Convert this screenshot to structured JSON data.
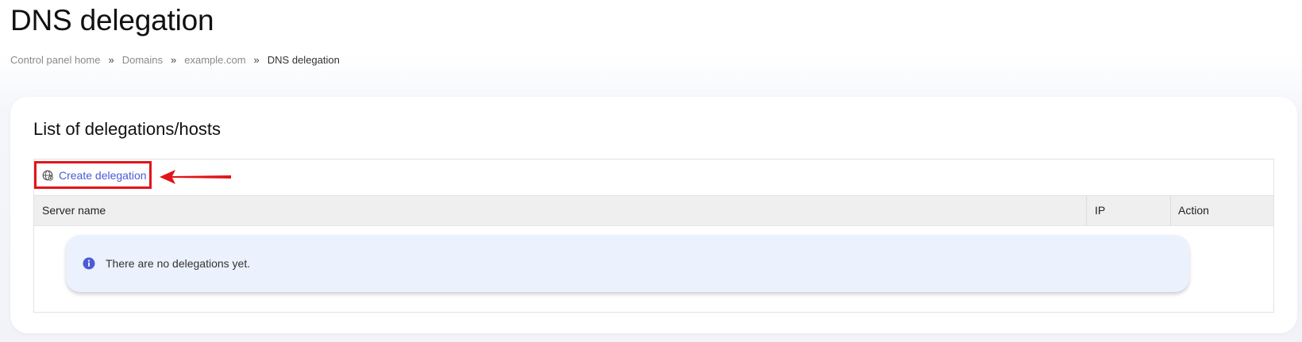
{
  "page": {
    "title": "DNS delegation"
  },
  "breadcrumb": {
    "items": [
      "Control panel home",
      "Domains",
      "example.com"
    ],
    "current": "DNS delegation",
    "separator": "»"
  },
  "card": {
    "title": "List of delegations/hosts"
  },
  "toolbar": {
    "create_label": "Create delegation",
    "create_icon": "globe-network-icon"
  },
  "table": {
    "columns": [
      "Server name",
      "IP",
      "Action"
    ]
  },
  "empty_state": {
    "icon": "info-icon",
    "message": "There are no delegations yet."
  },
  "colors": {
    "accent": "#4a5bd4",
    "highlight": "#e0151b",
    "info_background": "#ebf1fd"
  }
}
